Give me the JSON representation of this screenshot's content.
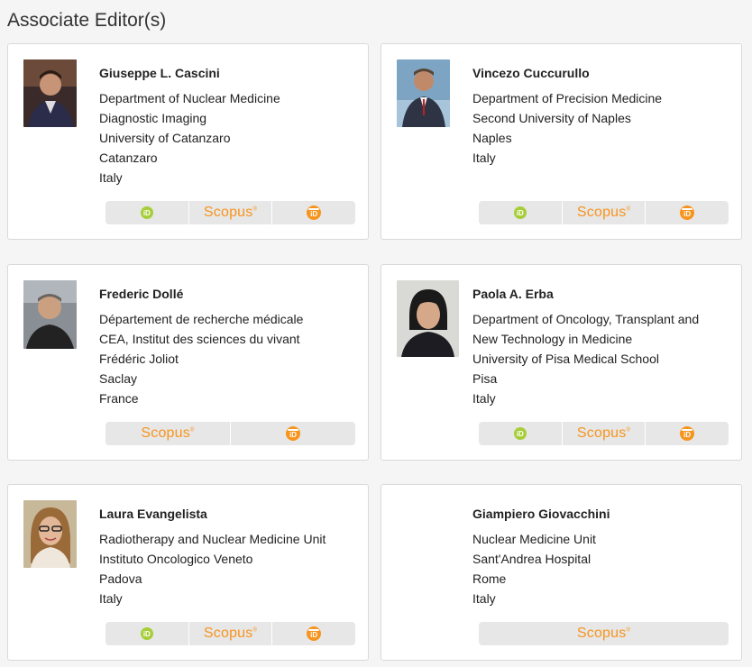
{
  "section": {
    "title": "Associate Editor(s)"
  },
  "icons": {
    "orcid": "orcid-icon",
    "scopus": "scopus-logo",
    "publons": "publons-icon",
    "orcid_label": "iD",
    "scopus_label": "Scopus",
    "publons_label": "iD"
  },
  "colors": {
    "orcid": "#a6ce39",
    "scopus": "#f7941e",
    "publons": "#f7941e"
  },
  "editors": [
    {
      "name": "Giuseppe L. Cascini",
      "lines": [
        "Department of Nuclear Medicine",
        "Diagnostic Imaging",
        "University of Catanzaro",
        "Catanzaro",
        "Italy"
      ],
      "links": [
        "orcid",
        "scopus",
        "publons"
      ],
      "has_photo": true
    },
    {
      "name": "Vincezo Cuccurullo",
      "lines": [
        "Department of Precision Medicine",
        "Second University of Naples",
        "Naples",
        "Italy"
      ],
      "links": [
        "orcid",
        "scopus",
        "publons"
      ],
      "has_photo": true
    },
    {
      "name": "Frederic Dollé",
      "lines": [
        "Département de recherche médicale",
        "CEA, Institut des sciences du vivant",
        "Frédéric Joliot",
        "Saclay",
        "France"
      ],
      "links": [
        "scopus",
        "publons"
      ],
      "has_photo": true
    },
    {
      "name": "Paola A. Erba",
      "lines": [
        "Department of Oncology, Transplant and",
        "New Technology in Medicine",
        "University of Pisa Medical School",
        "Pisa",
        "Italy"
      ],
      "links": [
        "orcid",
        "scopus",
        "publons"
      ],
      "has_photo": true
    },
    {
      "name": "Laura Evangelista",
      "lines": [
        "Radiotherapy and Nuclear Medicine Unit",
        "Instituto Oncologico Veneto",
        "Padova",
        "Italy"
      ],
      "links": [
        "orcid",
        "scopus",
        "publons"
      ],
      "has_photo": true
    },
    {
      "name": "Giampiero Giovacchini",
      "lines": [
        "Nuclear Medicine Unit",
        "Sant'Andrea Hospital",
        "Rome",
        "Italy"
      ],
      "links": [
        "scopus"
      ],
      "has_photo": false
    }
  ]
}
